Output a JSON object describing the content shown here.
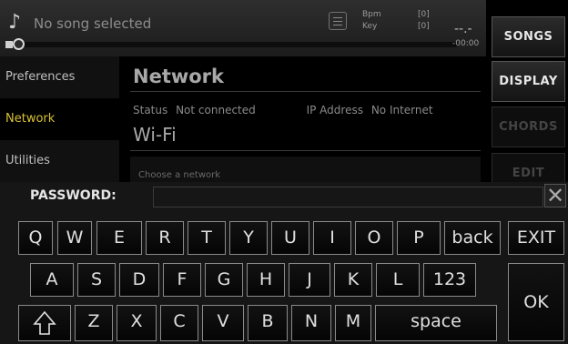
{
  "player": {
    "song_title": "No song selected",
    "note_icon": "music-note-icon",
    "bpm_label": "Bpm",
    "bpm_value": "[0]",
    "key_label": "Key",
    "key_value": "[0]",
    "time": "--.-",
    "remaining": "-00:00"
  },
  "side_buttons": {
    "songs": "SONGS",
    "display": "DISPLAY",
    "chords": "CHORDS",
    "edit": "EDIT"
  },
  "sidebar": {
    "items": [
      {
        "label": "Preferences"
      },
      {
        "label": "Network"
      },
      {
        "label": "Utilities"
      }
    ]
  },
  "network": {
    "heading": "Network",
    "status_label": "Status",
    "status_value": "Not connected",
    "ip_label": "IP Address",
    "ip_value": "No Internet",
    "wifi_heading": "Wi-Fi",
    "choose_hint": "Choose a network"
  },
  "keyboard": {
    "password_label": "PASSWORD:",
    "password_value": "",
    "clear_icon": "close-icon",
    "row1": [
      "Q",
      "W",
      "E",
      "R",
      "T",
      "Y",
      "U",
      "I",
      "O",
      "P",
      "back"
    ],
    "row2": [
      "A",
      "S",
      "D",
      "F",
      "G",
      "H",
      "J",
      "K",
      "L",
      "123"
    ],
    "row3": [
      "Z",
      "X",
      "C",
      "V",
      "B",
      "N",
      "M",
      "space"
    ],
    "exit": "EXIT",
    "ok": "OK",
    "shift_icon": "shift-arrow-icon"
  },
  "colors": {
    "accent": "#d8c034",
    "background": "#000000"
  }
}
